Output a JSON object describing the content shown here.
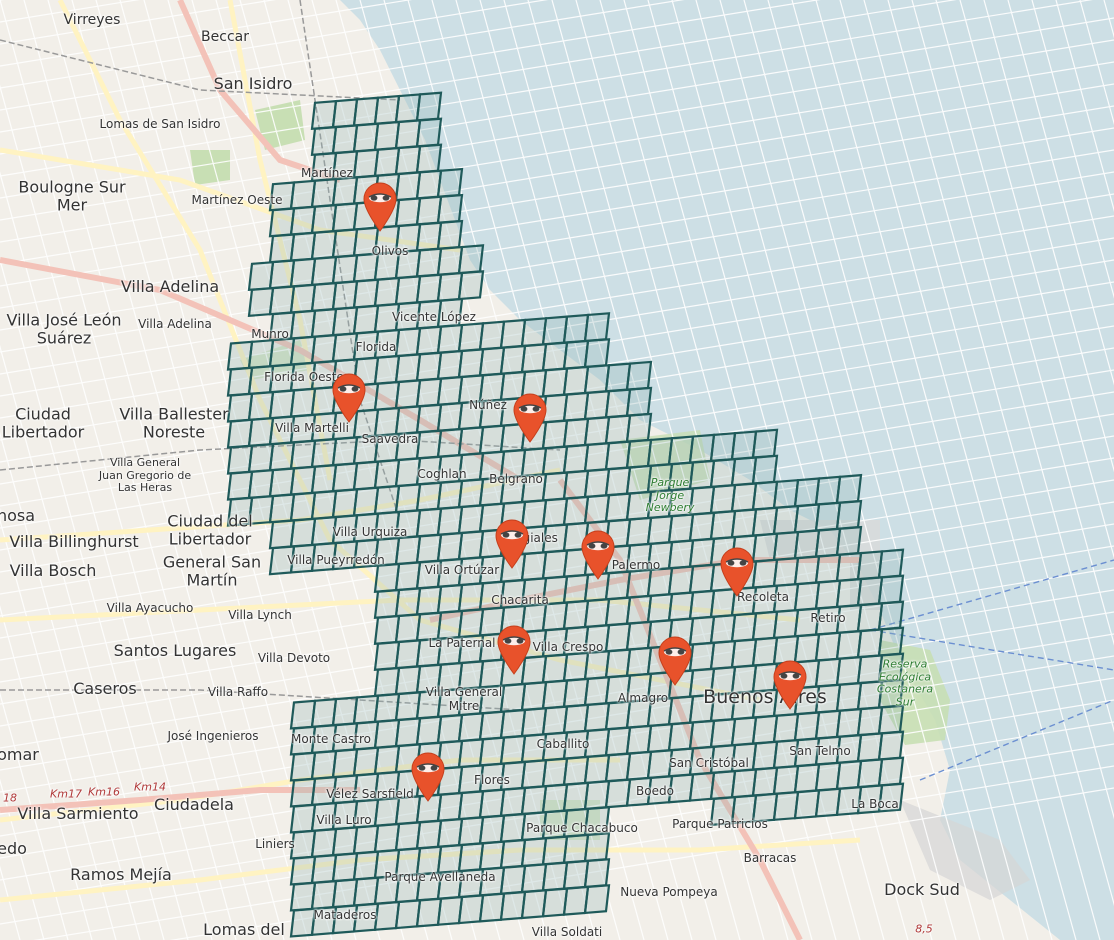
{
  "map": {
    "colors": {
      "water": "#cddfe5",
      "land": "#f2efe9",
      "grid_stroke": "#1f5a5a",
      "grid_fill": "#8fb3b3",
      "marker": "#e8522b",
      "highway": "#f3c2b8",
      "road": "#fff3c2"
    },
    "place_labels": [
      {
        "name": "place-virreyes",
        "text": "Virreyes",
        "size": "med"
      },
      {
        "name": "place-beccar",
        "text": "Beccar",
        "size": "med"
      },
      {
        "name": "place-san-isidro",
        "text": "San Isidro",
        "size": "big"
      },
      {
        "name": "place-lomas-de-san-isidro",
        "text": "Lomas de San Isidro",
        "size": "sm"
      },
      {
        "name": "place-boulogne-sur-mer",
        "text": "Boulogne Sur Mer",
        "size": "big"
      },
      {
        "name": "place-martinez",
        "text": "Martínez",
        "size": "sm"
      },
      {
        "name": "place-martinez-oeste",
        "text": "Martínez Oeste",
        "size": "sm"
      },
      {
        "name": "place-olivos",
        "text": "Olivos",
        "size": "sm"
      },
      {
        "name": "place-villa-adelina-1",
        "text": "Villa Adelina",
        "size": "big"
      },
      {
        "name": "place-villa-jose-leon-suarez",
        "text": "Villa José León Suárez",
        "size": "big"
      },
      {
        "name": "place-villa-adelina-2",
        "text": "Villa Adelina",
        "size": "sm"
      },
      {
        "name": "place-munro",
        "text": "Munro",
        "size": "sm"
      },
      {
        "name": "place-vicente-lopez",
        "text": "Vicente López",
        "size": "sm"
      },
      {
        "name": "place-florida",
        "text": "Florida",
        "size": "sm"
      },
      {
        "name": "place-florida-oeste",
        "text": "Florida Oeste",
        "size": "sm"
      },
      {
        "name": "place-ciudad-libertador",
        "text": "Ciudad Libertador",
        "size": "big"
      },
      {
        "name": "place-villa-ballester-noreste",
        "text": "Villa Ballester Noreste",
        "size": "big"
      },
      {
        "name": "place-villa-martelli",
        "text": "Villa Martelli",
        "size": "sm"
      },
      {
        "name": "place-saavedra",
        "text": "Saavedra",
        "size": "sm"
      },
      {
        "name": "place-nunez",
        "text": "Núñez",
        "size": "sm"
      },
      {
        "name": "place-villa-general-juan-gregorio-de-las-heras",
        "text": "Villa General Juan Gregorio de Las Heras",
        "size": "xs"
      },
      {
        "name": "place-coghlan",
        "text": "Coghlan",
        "size": "sm"
      },
      {
        "name": "place-belgrano",
        "text": "Belgrano",
        "size": "sm"
      },
      {
        "name": "place-hosa",
        "text": "hosa",
        "size": "big"
      },
      {
        "name": "place-ciudad-del-libertador",
        "text": "Ciudad del Libertador",
        "size": "big"
      },
      {
        "name": "place-villa-billinghurst",
        "text": "Villa Billinghurst",
        "size": "big"
      },
      {
        "name": "place-general-san-martin",
        "text": "General San Martín",
        "size": "big"
      },
      {
        "name": "place-villa-bosch",
        "text": "Villa Bosch",
        "size": "big"
      },
      {
        "name": "place-villa-urquiza",
        "text": "Villa Urquiza",
        "size": "sm"
      },
      {
        "name": "place-villa-pueyrredon",
        "text": "Villa Pueyrredón",
        "size": "sm"
      },
      {
        "name": "place-villa-ortuzar",
        "text": "Villa Ortúzar",
        "size": "sm"
      },
      {
        "name": "place-colegiales",
        "text": "Colegiales",
        "size": "sm"
      },
      {
        "name": "place-palermo",
        "text": "Palermo",
        "size": "sm"
      },
      {
        "name": "place-chacarita",
        "text": "Chacarita",
        "size": "sm"
      },
      {
        "name": "place-recoleta",
        "text": "Recoleta",
        "size": "sm"
      },
      {
        "name": "place-retiro",
        "text": "Retiro",
        "size": "sm"
      },
      {
        "name": "place-villa-ayacucho",
        "text": "Villa Ayacucho",
        "size": "sm"
      },
      {
        "name": "place-villa-lynch",
        "text": "Villa Lynch",
        "size": "sm"
      },
      {
        "name": "place-la-paternal",
        "text": "La Paternal",
        "size": "sm"
      },
      {
        "name": "place-villa-crespo",
        "text": "Villa Crespo",
        "size": "sm"
      },
      {
        "name": "place-santos-lugares",
        "text": "Santos Lugares",
        "size": "big"
      },
      {
        "name": "place-villa-devoto",
        "text": "Villa Devoto",
        "size": "sm"
      },
      {
        "name": "place-caseros",
        "text": "Caseros",
        "size": "big"
      },
      {
        "name": "place-villa-raffo",
        "text": "Villa Raffo",
        "size": "sm"
      },
      {
        "name": "place-villa-general-mitre",
        "text": "Villa General Mitre",
        "size": "sm"
      },
      {
        "name": "place-almagro",
        "text": "Almagro",
        "size": "sm"
      },
      {
        "name": "place-buenos-aires",
        "text": "Buenos Aires",
        "size": "city"
      },
      {
        "name": "place-jose-ingenieros",
        "text": "José Ingenieros",
        "size": "sm"
      },
      {
        "name": "place-monte-castro",
        "text": "Monte Castro",
        "size": "sm"
      },
      {
        "name": "place-caballito",
        "text": "Caballito",
        "size": "sm"
      },
      {
        "name": "place-san-telmo",
        "text": "San Telmo",
        "size": "sm"
      },
      {
        "name": "place-omar",
        "text": "omar",
        "size": "big"
      },
      {
        "name": "place-san-cristobal",
        "text": "San Cristóbal",
        "size": "sm"
      },
      {
        "name": "place-flores",
        "text": "Flores",
        "size": "sm"
      },
      {
        "name": "place-velez-sarsfield",
        "text": "Vélez Sarsfield",
        "size": "sm"
      },
      {
        "name": "place-boedo",
        "text": "Boedo",
        "size": "sm"
      },
      {
        "name": "place-ciudadela",
        "text": "Ciudadela",
        "size": "big"
      },
      {
        "name": "place-la-boca",
        "text": "La Boca",
        "size": "sm"
      },
      {
        "name": "place-villa-sarmiento",
        "text": "Villa Sarmiento",
        "size": "big"
      },
      {
        "name": "place-villa-luro",
        "text": "Villa Luro",
        "size": "sm"
      },
      {
        "name": "place-parque-chacabuco",
        "text": "Parque Chacabuco",
        "size": "sm"
      },
      {
        "name": "place-parque-patricios",
        "text": "Parque Patricios",
        "size": "sm"
      },
      {
        "name": "place-edo",
        "text": "edo",
        "size": "big"
      },
      {
        "name": "place-liniers",
        "text": "Liniers",
        "size": "sm"
      },
      {
        "name": "place-barracas",
        "text": "Barracas",
        "size": "sm"
      },
      {
        "name": "place-ramos-mejia",
        "text": "Ramos Mejía",
        "size": "big"
      },
      {
        "name": "place-parque-avellaneda",
        "text": "Parque Avellaneda",
        "size": "sm"
      },
      {
        "name": "place-nueva-pompeya",
        "text": "Nueva Pompeya",
        "size": "sm"
      },
      {
        "name": "place-dock-sud",
        "text": "Dock Sud",
        "size": "big"
      },
      {
        "name": "place-mataderos",
        "text": "Mataderos",
        "size": "sm"
      },
      {
        "name": "place-lomas-del",
        "text": "Lomas del",
        "size": "big"
      },
      {
        "name": "place-villa-soldati",
        "text": "Villa Soldati",
        "size": "sm"
      }
    ],
    "road_labels": [
      {
        "name": "road-km18",
        "text": "18"
      },
      {
        "name": "road-km17",
        "text": "Km17"
      },
      {
        "name": "road-km16",
        "text": "Km16"
      },
      {
        "name": "road-km14",
        "text": "Km14"
      },
      {
        "name": "road-8-5",
        "text": "8,5"
      }
    ],
    "park_labels": [
      {
        "name": "park-jorge-newbery",
        "text": "Parque Jorge Newbery"
      },
      {
        "name": "park-reserva-ecologica",
        "text": "Reserva Ecológica Costanera Sur"
      }
    ],
    "markers": [
      {
        "name": "marker-1",
        "icon": "eye-mask-icon"
      },
      {
        "name": "marker-2",
        "icon": "eye-mask-icon"
      },
      {
        "name": "marker-3",
        "icon": "eye-mask-icon"
      },
      {
        "name": "marker-4",
        "icon": "eye-mask-icon"
      },
      {
        "name": "marker-5",
        "icon": "eye-mask-icon"
      },
      {
        "name": "marker-6",
        "icon": "eye-mask-icon"
      },
      {
        "name": "marker-7",
        "icon": "eye-mask-icon"
      },
      {
        "name": "marker-8",
        "icon": "eye-mask-icon"
      },
      {
        "name": "marker-9",
        "icon": "eye-mask-icon"
      },
      {
        "name": "marker-10",
        "icon": "eye-mask-icon"
      },
      {
        "name": "marker-11",
        "icon": "eye-mask-icon"
      }
    ]
  }
}
